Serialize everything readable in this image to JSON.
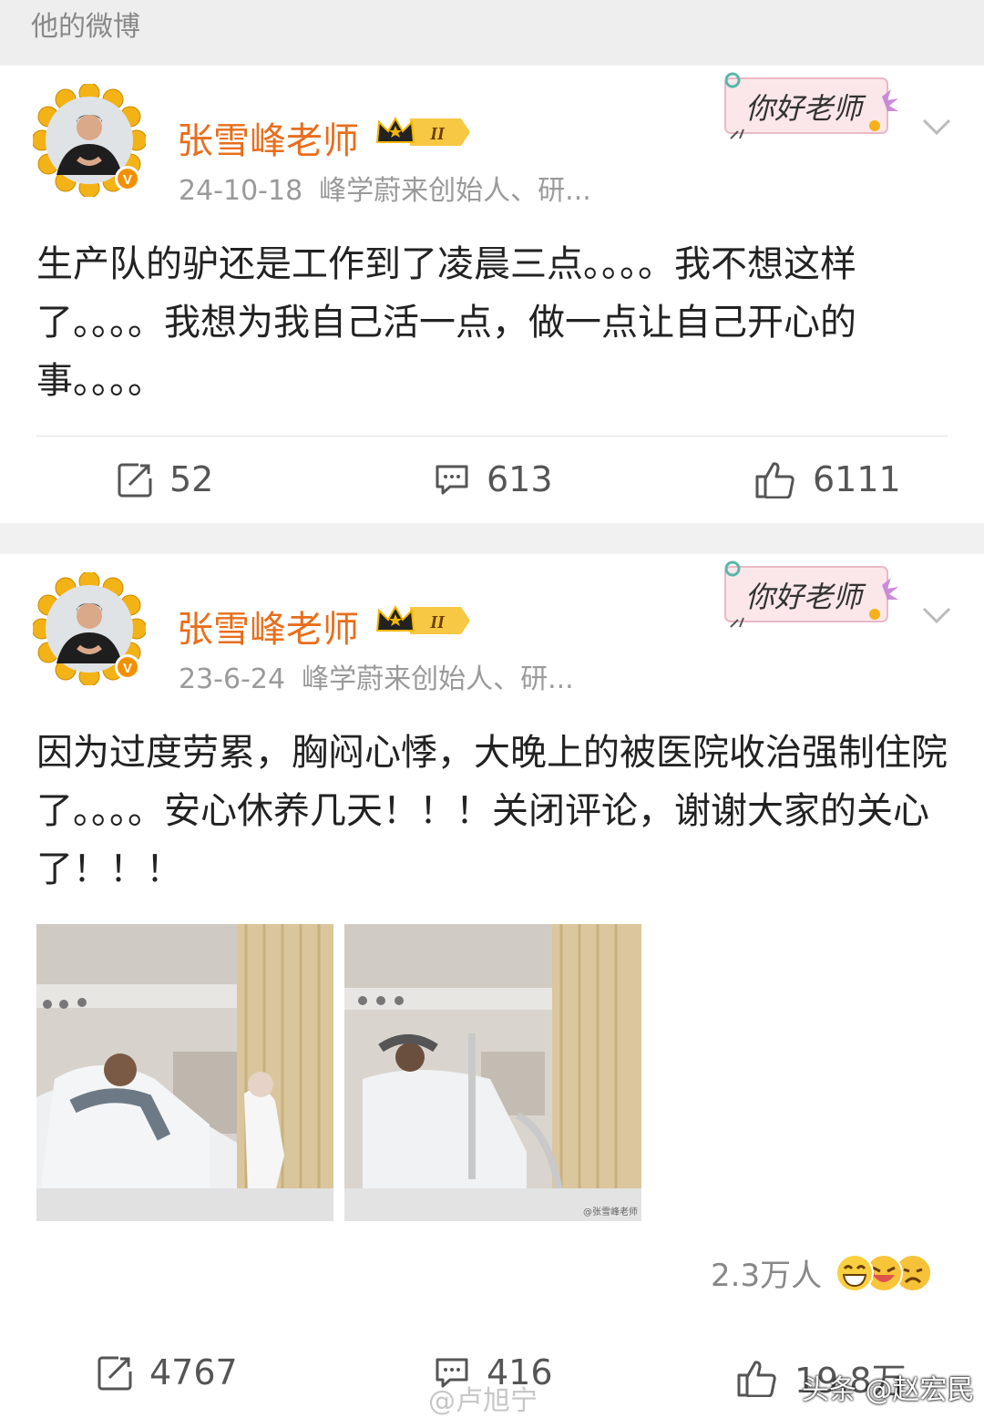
{
  "header": {
    "title": "他的微博"
  },
  "posts": [
    {
      "author": "张雪峰老师",
      "date": "24-10-18",
      "bio": "峰学蔚来创始人、研...",
      "sticker_text": "你好老师",
      "content": "生产队的驴还是工作到了凌晨三点。。。。我不想这样了。。。。我想为我自己活一点，做一点让自己开心的事。。。。",
      "reposts": "52",
      "comments": "613",
      "likes": "6111"
    },
    {
      "author": "张雪峰老师",
      "date": "23-6-24",
      "bio": "峰学蔚来创始人、研...",
      "sticker_text": "你好老师",
      "content": "因为过度劳累，胸闷心悸，大晚上的被医院收治强制住院了。。。。安心休养几天！！！关闭评论，谢谢大家的关心了！！！",
      "reaction_count": "2.3万人",
      "reposts": "4767",
      "comments": "416",
      "likes": "19.8万"
    }
  ],
  "photo_watermark": "@张雪峰老师",
  "watermarks": {
    "weibo": "@卢旭宁",
    "toutiao": "头条 @赵宏民"
  },
  "colors": {
    "author": "#e86e1c",
    "badge_gold": "#f5b800",
    "background": "#f1f1f1"
  }
}
